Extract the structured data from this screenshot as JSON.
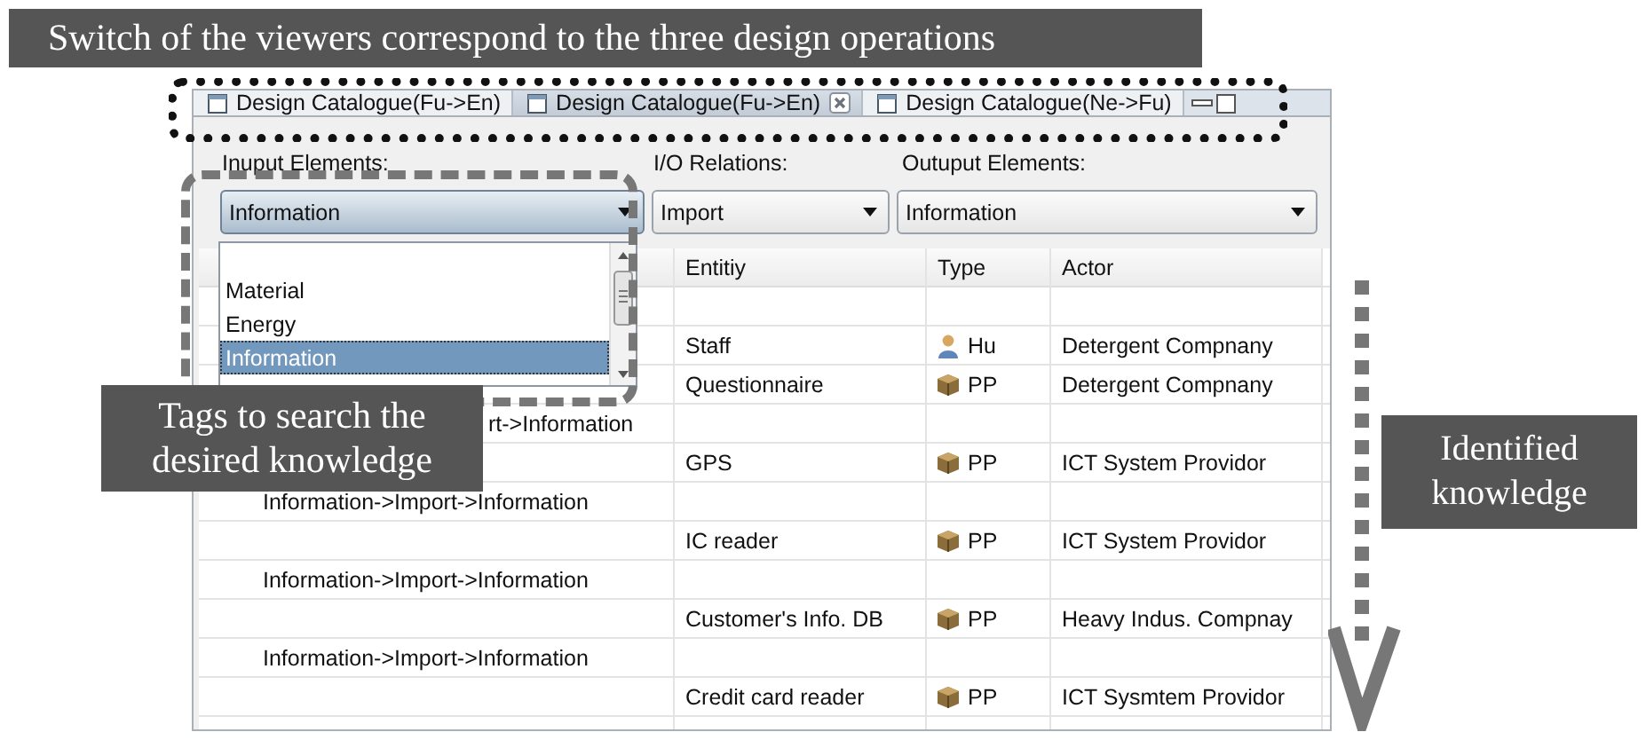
{
  "caption": {
    "text": "Switch of the viewers correspond to the three design operations"
  },
  "tabs": [
    {
      "label": "Design Catalogue(Fu->En)",
      "selected": false
    },
    {
      "label": "Design Catalogue(Fu->En)",
      "selected": true
    },
    {
      "label": "Design Catalogue(Ne->Fu)",
      "selected": false
    }
  ],
  "filters": [
    {
      "label": "Inuput Elements:",
      "value": "Information",
      "open": true
    },
    {
      "label": "I/O Relations:",
      "value": "Import",
      "open": false
    },
    {
      "label": "Outuput Elements:",
      "value": "Information",
      "open": false
    }
  ],
  "dropdown_list": {
    "items": [
      {
        "label": "Material",
        "selected": false
      },
      {
        "label": "Energy",
        "selected": false
      },
      {
        "label": "Information",
        "selected": true
      }
    ]
  },
  "table": {
    "columns": [
      "Entitiy",
      "Type",
      "Actor"
    ],
    "rows": [
      {
        "kind": "blank"
      },
      {
        "kind": "human",
        "entity": "Staff",
        "type": "Hu",
        "actor": "Detergent Compnany"
      },
      {
        "kind": "product",
        "entity": "Questionnaire",
        "type": "PP",
        "actor": "Detergent Compnany"
      },
      {
        "kind": "relation",
        "text": "rt->Information"
      },
      {
        "kind": "product",
        "entity": "GPS",
        "type": "PP",
        "actor": "ICT System Providor"
      },
      {
        "kind": "relation",
        "text": "Information->Import->Information"
      },
      {
        "kind": "product",
        "entity": "IC reader",
        "type": "PP",
        "actor": "ICT System Providor"
      },
      {
        "kind": "relation",
        "text": "Information->Import->Information"
      },
      {
        "kind": "product",
        "entity": "Customer's Info. DB",
        "type": "PP",
        "actor": "Heavy Indus. Compnay"
      },
      {
        "kind": "relation",
        "text": "Information->Import->Information"
      },
      {
        "kind": "product",
        "entity": "Credit card reader",
        "type": "PP",
        "actor": "ICT Sysmtem Providor"
      },
      {
        "kind": "blank"
      }
    ]
  },
  "notes": [
    {
      "kind": "search",
      "text": "Tags to search the desired knowledge"
    },
    {
      "kind": "result",
      "text": "Identified knowledge"
    }
  ]
}
